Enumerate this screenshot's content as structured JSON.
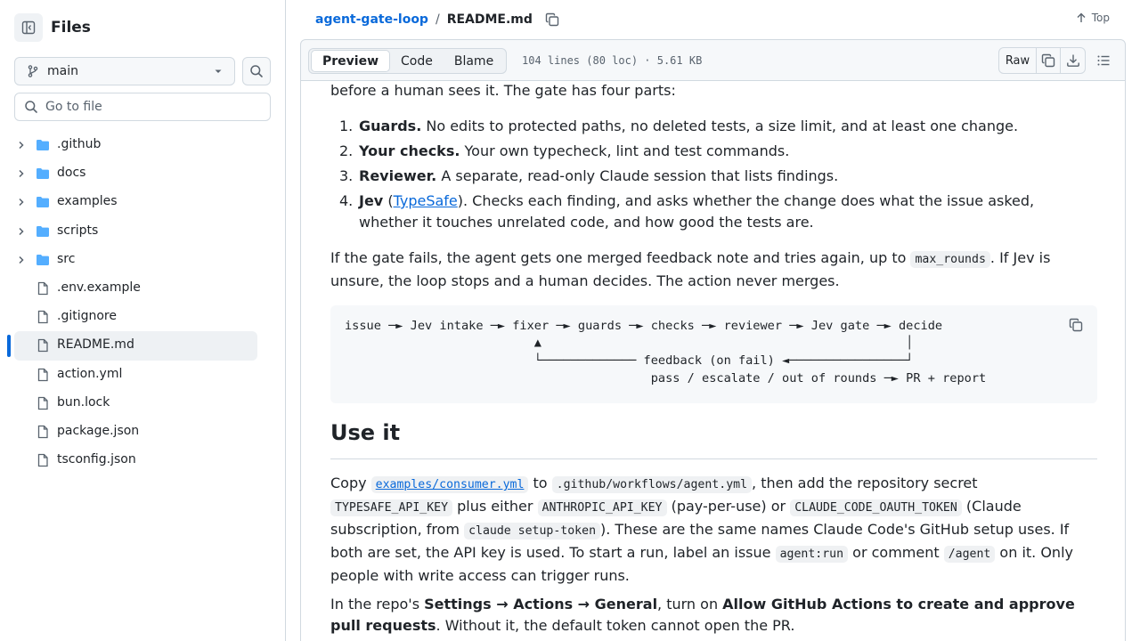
{
  "sidebar": {
    "title": "Files",
    "branch": "main",
    "goto_placeholder": "Go to file",
    "items": [
      {
        "name": ".github",
        "type": "folder"
      },
      {
        "name": "docs",
        "type": "folder"
      },
      {
        "name": "examples",
        "type": "folder"
      },
      {
        "name": "scripts",
        "type": "folder"
      },
      {
        "name": "src",
        "type": "folder"
      },
      {
        "name": ".env.example",
        "type": "file"
      },
      {
        "name": ".gitignore",
        "type": "file"
      },
      {
        "name": "README.md",
        "type": "file",
        "active": true
      },
      {
        "name": "action.yml",
        "type": "file"
      },
      {
        "name": "bun.lock",
        "type": "file"
      },
      {
        "name": "package.json",
        "type": "file"
      },
      {
        "name": "tsconfig.json",
        "type": "file"
      }
    ]
  },
  "header": {
    "repo": "agent-gate-loop",
    "sep": "/",
    "file": "README.md",
    "top_label": "Top"
  },
  "filebar": {
    "tabs": [
      "Preview",
      "Code",
      "Blame"
    ],
    "selected_tab": "Preview",
    "info": "104 lines (80 loc) · 5.61 KB",
    "raw_label": "Raw"
  },
  "readme": {
    "intro_tail": "before a human sees it. The gate has four parts:",
    "list": [
      {
        "num": "1.",
        "bold": "Guards.",
        "text": " No edits to protected paths, no deleted tests, a size limit, and at least one change."
      },
      {
        "num": "2.",
        "bold": "Your checks.",
        "text": " Your own typecheck, lint and test commands."
      },
      {
        "num": "3.",
        "bold": "Reviewer.",
        "text": " A separate, read-only Claude session that lists findings."
      },
      {
        "num": "4.",
        "bold": "Jev",
        "pre_link": " (",
        "link": "TypeSafe",
        "text_line1": "). Checks each finding, and asks whether the change does what the issue asked,",
        "text_line2": "whether it touches unrelated code, and how good the tests are."
      }
    ],
    "fail_p": {
      "a": "If the gate fails, the agent gets one merged feedback note and tries again, up to ",
      "code": "max_rounds",
      "b": ". If Jev is",
      "c": "unsure, the loop stops and a human decides. The action never merges."
    },
    "diagram": {
      "line1": "issue ─► Jev intake ─► fixer ─► guards ─► checks ─► reviewer ─► Jev gate ─► decide",
      "line2": "                          ▲                                                  │",
      "line3": "                          └───────────── feedback (on fail) ◄────────────────┘",
      "line4": "                                          pass / escalate / out of rounds ─► PR + report"
    },
    "h2": "Use it",
    "use_p": {
      "l1a": "Copy ",
      "l1link": "examples/consumer.yml",
      "l1b": " to ",
      "l1code": ".github/workflows/agent.yml",
      "l1c": ", then add the repository secret",
      "l2code1": "TYPESAFE_API_KEY",
      "l2a": " plus either ",
      "l2code2": "ANTHROPIC_API_KEY",
      "l2b": " (pay-per-use) or ",
      "l2code3": "CLAUDE_CODE_OAUTH_TOKEN",
      "l2c": " (Claude",
      "l3a": "subscription, from ",
      "l3code": "claude setup-token",
      "l3b": "). These are the same names Claude Code's GitHub setup uses. If",
      "l4a": "both are set, the API key is used. To start a run, label an issue ",
      "l4code1": "agent:run",
      "l4b": " or comment ",
      "l4code2": "/agent",
      "l4c": " on it. Only",
      "l5": "people with write access can trigger runs."
    },
    "settings_p": {
      "a": "In the repo's ",
      "b1": "Settings → Actions → General",
      "c": ", turn on ",
      "b2": "Allow GitHub Actions to create and approve",
      "b3": "pull requests",
      "d": ". Without it, the default token cannot open the PR."
    }
  }
}
